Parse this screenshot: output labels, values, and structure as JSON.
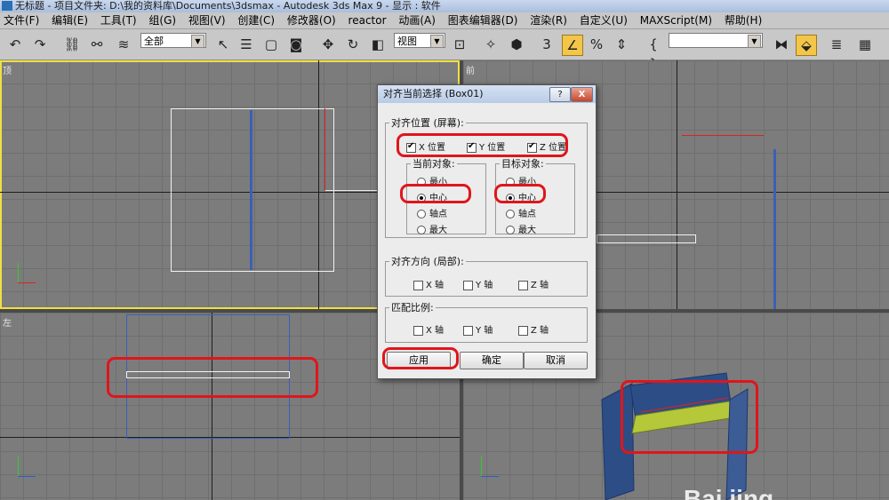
{
  "window": {
    "title": "无标题      - 项目文件夹: D:\\我的资料库\\Documents\\3dsmax      - Autodesk 3ds Max 9      - 显示 : 软件"
  },
  "menu": [
    "文件(F)",
    "编辑(E)",
    "工具(T)",
    "组(G)",
    "视图(V)",
    "创建(C)",
    "修改器(O)",
    "reactor",
    "动画(A)",
    "图表编辑器(D)",
    "渲染(R)",
    "自定义(U)",
    "MAXScript(M)",
    "帮助(H)"
  ],
  "toolbar": {
    "selection_filter": "全部",
    "reference_coord": "视图",
    "snap_label": "3",
    "named_selection": ""
  },
  "viewports": {
    "top": "顶",
    "front": "前",
    "left": "左",
    "perspective": ""
  },
  "dialog": {
    "title": "对齐当前选择 (Box01)",
    "help": "?",
    "close": "X",
    "align_position": {
      "legend": "对齐位置 (屏幕):",
      "x": "X 位置",
      "y": "Y 位置",
      "z": "Z 位置"
    },
    "current_object": {
      "legend": "当前对象:",
      "options": [
        "最小",
        "中心",
        "轴点",
        "最大"
      ],
      "selected": "中心"
    },
    "target_object": {
      "legend": "目标对象:",
      "options": [
        "最小",
        "中心",
        "轴点",
        "最大"
      ],
      "selected": "中心"
    },
    "align_orientation": {
      "legend": "对齐方向 (局部):",
      "x": "X 轴",
      "y": "Y 轴",
      "z": "Z 轴"
    },
    "match_scale": {
      "legend": "匹配比例:",
      "x": "X 轴",
      "y": "Y 轴",
      "z": "Z 轴"
    },
    "buttons": {
      "apply": "应用",
      "ok": "确定",
      "cancel": "取消"
    }
  },
  "watermark": "Bai jing",
  "colors": {
    "highlight": "#e0151b",
    "active_viewport": "#f0e040",
    "box_blue": "#2d4d86",
    "box_green": "#b4c83a"
  }
}
